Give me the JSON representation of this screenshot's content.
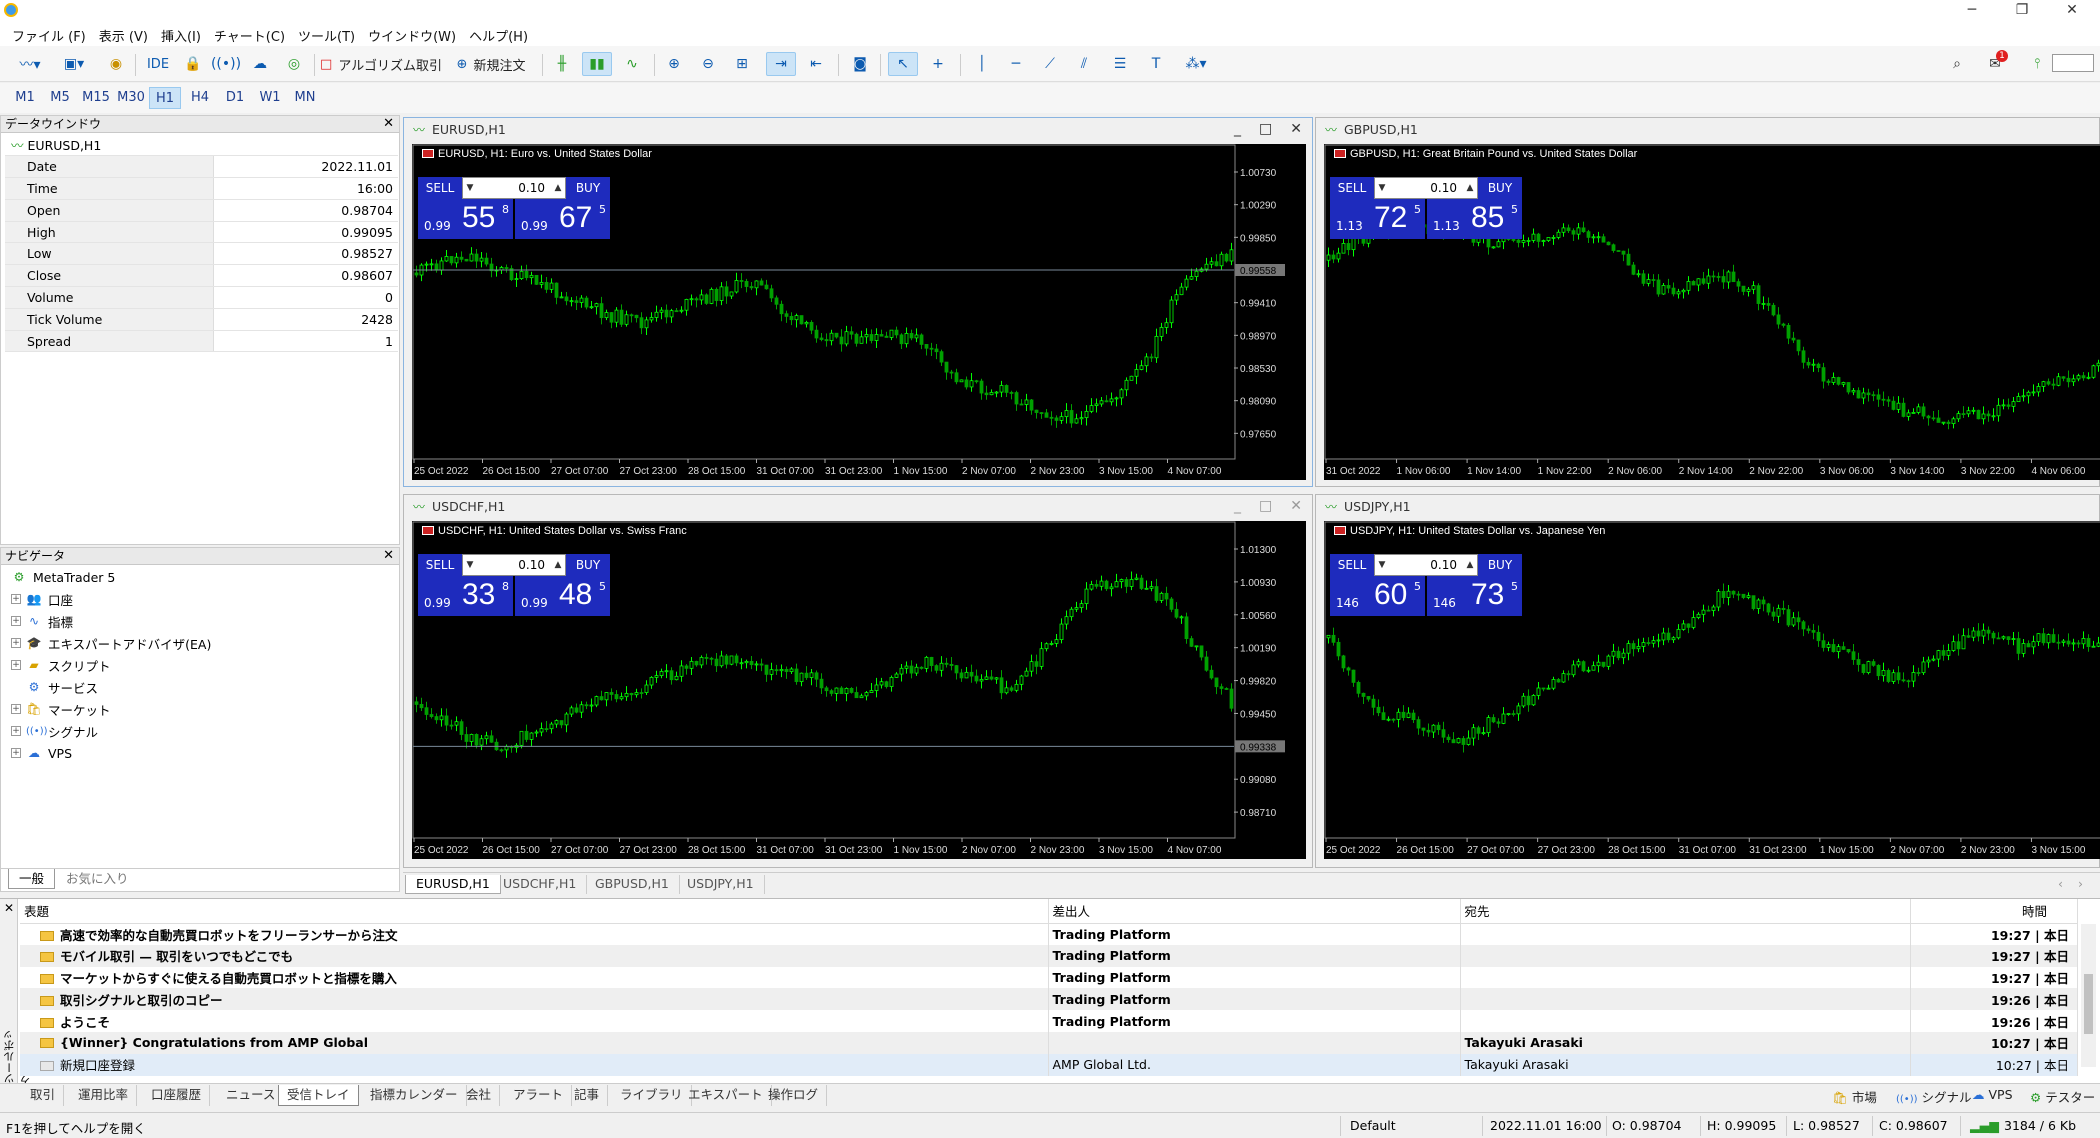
{
  "window": {
    "minimize": "─",
    "restore": "❐",
    "close": "✕"
  },
  "menu": [
    "ファイル (F)",
    "表示 (V)",
    "挿入(I)",
    "チャート(C)",
    "ツール(T)",
    "ウインドウ(W)",
    "ヘルプ(H)"
  ],
  "toolbar": {
    "ide": "IDE",
    "algo_trading": "アルゴリズム取引",
    "new_order": "新規注文",
    "notification_count": "1"
  },
  "timeframes": [
    "M1",
    "M5",
    "M15",
    "M30",
    "H1",
    "H4",
    "D1",
    "W1",
    "MN"
  ],
  "active_timeframe": "H1",
  "data_window": {
    "title": "データウインドウ",
    "symbol": "EURUSD,H1",
    "rows": [
      {
        "key": "Date",
        "value": "2022.11.01"
      },
      {
        "key": "Time",
        "value": "16:00"
      },
      {
        "key": "Open",
        "value": "0.98704"
      },
      {
        "key": "High",
        "value": "0.99095"
      },
      {
        "key": "Low",
        "value": "0.98527"
      },
      {
        "key": "Close",
        "value": "0.98607"
      },
      {
        "key": "Volume",
        "value": "0"
      },
      {
        "key": "Tick Volume",
        "value": "2428"
      },
      {
        "key": "Spread",
        "value": "1"
      }
    ]
  },
  "navigator": {
    "title": "ナビゲータ",
    "root": "MetaTrader 5",
    "items": [
      "口座",
      "指標",
      "エキスパートアドバイザ(EA)",
      "スクリプト",
      "サービス",
      "マーケット",
      "シグナル",
      "VPS"
    ],
    "tabs": [
      "一般",
      "お気に入り"
    ]
  },
  "charts": [
    {
      "title": "EURUSD,H1",
      "header": "EURUSD, H1:  Euro vs. United States Dollar",
      "lot": "0.10",
      "sell_label": "SELL",
      "buy_label": "BUY",
      "sell_small": "0.99",
      "sell_big": "55",
      "sell_sup": "8",
      "buy_small": "0.99",
      "buy_big": "67",
      "buy_sup": "5",
      "price_labels": [
        "1.00730",
        "1.00290",
        "0.99850",
        "0.99558",
        "0.99410",
        "0.98970",
        "0.98530",
        "0.98090",
        "0.97650"
      ],
      "current_price": "0.99558",
      "time_labels": [
        "25 Oct 2022",
        "26 Oct 15:00",
        "27 Oct 07:00",
        "27 Oct 23:00",
        "28 Oct 15:00",
        "31 Oct 07:00",
        "31 Oct 23:00",
        "1 Nov 15:00",
        "2 Nov 07:00",
        "2 Nov 23:00",
        "3 Nov 15:00",
        "4 Nov 07:00"
      ],
      "win_buttons": [
        "_",
        "□",
        "✕"
      ]
    },
    {
      "title": "GBPUSD,H1",
      "header": "GBPUSD, H1:  Great Britain Pound vs. United States Dollar",
      "lot": "0.10",
      "sell_label": "SELL",
      "buy_label": "BUY",
      "sell_small": "1.13",
      "sell_big": "72",
      "sell_sup": "5",
      "buy_small": "1.13",
      "buy_big": "85",
      "buy_sup": "5",
      "price_labels": [],
      "current_price": "",
      "time_labels": [
        "31 Oct 2022",
        "1 Nov 06:00",
        "1 Nov 14:00",
        "1 Nov 22:00",
        "2 Nov 06:00",
        "2 Nov 14:00",
        "2 Nov 22:00",
        "3 Nov 06:00",
        "3 Nov 14:00",
        "3 Nov 22:00",
        "4 Nov 06:00"
      ],
      "win_buttons": []
    },
    {
      "title": "USDCHF,H1",
      "header": "USDCHF, H1:  United States Dollar vs. Swiss Franc",
      "lot": "0.10",
      "sell_label": "SELL",
      "buy_label": "BUY",
      "sell_small": "0.99",
      "sell_big": "33",
      "sell_sup": "8",
      "buy_small": "0.99",
      "buy_big": "48",
      "buy_sup": "5",
      "price_labels": [
        "1.01300",
        "1.00930",
        "1.00560",
        "1.00190",
        "0.99820",
        "0.99450",
        "0.99338",
        "0.99080",
        "0.98710"
      ],
      "current_price": "0.99338",
      "time_labels": [
        "25 Oct 2022",
        "26 Oct 15:00",
        "27 Oct 07:00",
        "27 Oct 23:00",
        "28 Oct 15:00",
        "31 Oct 07:00",
        "31 Oct 23:00",
        "1 Nov 15:00",
        "2 Nov 07:00",
        "2 Nov 23:00",
        "3 Nov 15:00",
        "4 Nov 07:00"
      ],
      "win_buttons": [
        "_",
        "□",
        "✕"
      ]
    },
    {
      "title": "USDJPY,H1",
      "header": "USDJPY, H1:  United States Dollar vs. Japanese Yen",
      "lot": "0.10",
      "sell_label": "SELL",
      "buy_label": "BUY",
      "sell_small": "146",
      "sell_big": "60",
      "sell_sup": "5",
      "buy_small": "146",
      "buy_big": "73",
      "buy_sup": "5",
      "price_labels": [],
      "current_price": "",
      "time_labels": [
        "25 Oct 2022",
        "26 Oct 15:00",
        "27 Oct 07:00",
        "27 Oct 23:00",
        "28 Oct 15:00",
        "31 Oct 07:00",
        "31 Oct 23:00",
        "1 Nov 15:00",
        "2 Nov 07:00",
        "2 Nov 23:00",
        "3 Nov 15:00"
      ],
      "win_buttons": []
    }
  ],
  "chart_tabs": [
    "EURUSD,H1",
    "USDCHF,H1",
    "GBPUSD,H1",
    "USDJPY,H1"
  ],
  "toolbox": {
    "side_label": "ツールボックス",
    "columns": [
      "表題",
      "差出人",
      "宛先",
      "時間"
    ],
    "rows": [
      {
        "subject": "高速で効率的な自動売買ロボットをフリーランサーから注文",
        "from": "Trading Platform",
        "to": "",
        "time": "19:27 | 本日"
      },
      {
        "subject": "モバイル取引 — 取引をいつでもどこでも",
        "from": "Trading Platform",
        "to": "",
        "time": "19:27 | 本日"
      },
      {
        "subject": "マーケットからすぐに使える自動売買ロボットと指標を購入",
        "from": "Trading Platform",
        "to": "",
        "time": "19:27 | 本日"
      },
      {
        "subject": "取引シグナルと取引のコピー",
        "from": "Trading Platform",
        "to": "",
        "time": "19:26 | 本日"
      },
      {
        "subject": "ようこそ",
        "from": "Trading Platform",
        "to": "",
        "time": "19:26 | 本日"
      },
      {
        "subject": "{Winner} Congratulations from AMP Global",
        "from": "",
        "to": "Takayuki Arasaki",
        "time": "10:27 | 本日"
      },
      {
        "subject": "新規口座登録",
        "from": "AMP Global Ltd.",
        "to": "Takayuki Arasaki",
        "time": "10:27 | 本日"
      }
    ],
    "tabs": [
      "取引",
      "運用比率",
      "口座履歴",
      "ニュース",
      "受信トレイ",
      "指標カレンダー",
      "会社",
      "アラート",
      "記事",
      "ライブラリ",
      "エキスパート",
      "操作ログ"
    ],
    "active_tab": "受信トレイ",
    "right_items": [
      "市場",
      "シグナル",
      "VPS",
      "テスター"
    ]
  },
  "status": {
    "help": "F1を押してヘルプを開く",
    "profile": "Default",
    "datetime": "2022.11.01 16:00",
    "open": "O: 0.98704",
    "high": "H: 0.99095",
    "low": "L: 0.98527",
    "close": "C: 0.98607",
    "traffic": "3184 / 6 Kb"
  },
  "colors": {
    "bull": "#00ff00",
    "bear": "#00a000",
    "chart_bg": "#000000",
    "trade_blue": "#1e2bbd"
  }
}
